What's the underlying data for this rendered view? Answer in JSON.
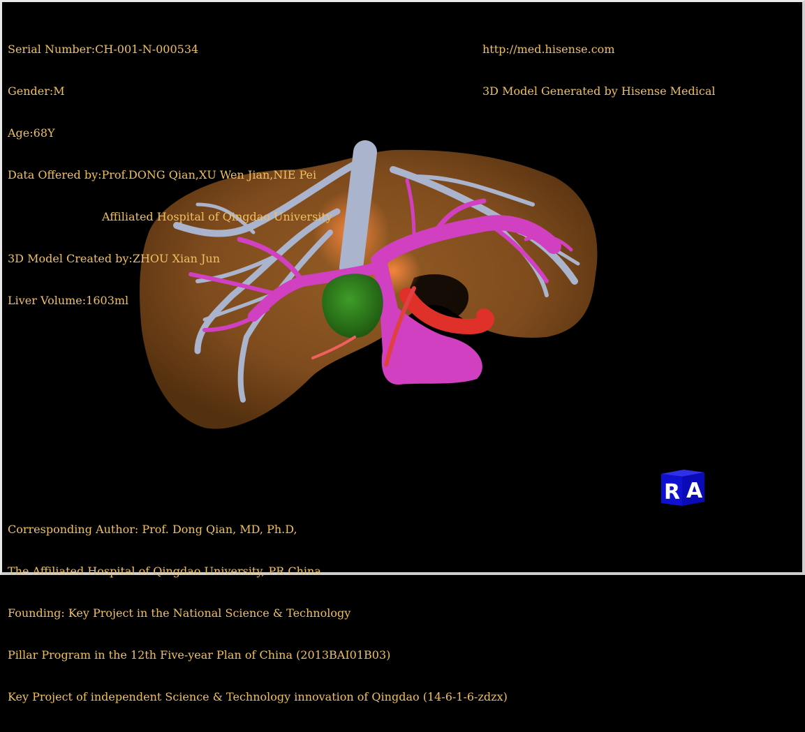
{
  "top_left": {
    "serial_number": "Serial Number:CH-001-N-000534",
    "gender": "Gender:M",
    "age": "Age:68Y",
    "data_offered_by": "Data Offered by:Prof.DONG Qian,XU Wen Jian,NIE Pei",
    "affiliation": "Affiliated Hospital of Qingdao University",
    "model_created_by": "3D Model Created by:ZHOU Xian Jun",
    "liver_volume": "Liver Volume:1603ml"
  },
  "top_right": {
    "url": "http://med.hisense.com",
    "generated_by": "3D Model Generated by Hisense Medical"
  },
  "bottom_left": {
    "line1": "Corresponding Author: Prof. Dong Qian, MD, Ph.D,",
    "line2": "The Affiliated Hospital of Qingdao University, PR China",
    "line3": "Founding: Key Project in the National Science & Technology",
    "line4": "Pillar Program in the 12th Five-year Plan of China (2013BAI01B03)",
    "line5": "Key Project of independent Science & Technology innovation of Qingdao (14-6-1-6-zdzx)"
  },
  "orientation_cube": {
    "left_face": "R",
    "right_face": "A"
  },
  "colors": {
    "text": "#f0c060",
    "liver": "#8a5220",
    "hepatic_veins": "#aab4cc",
    "portal_vein": "#d040c0",
    "tumor": "#2a8a1a",
    "artery": "#e0302a",
    "cube": "#1010d0"
  }
}
